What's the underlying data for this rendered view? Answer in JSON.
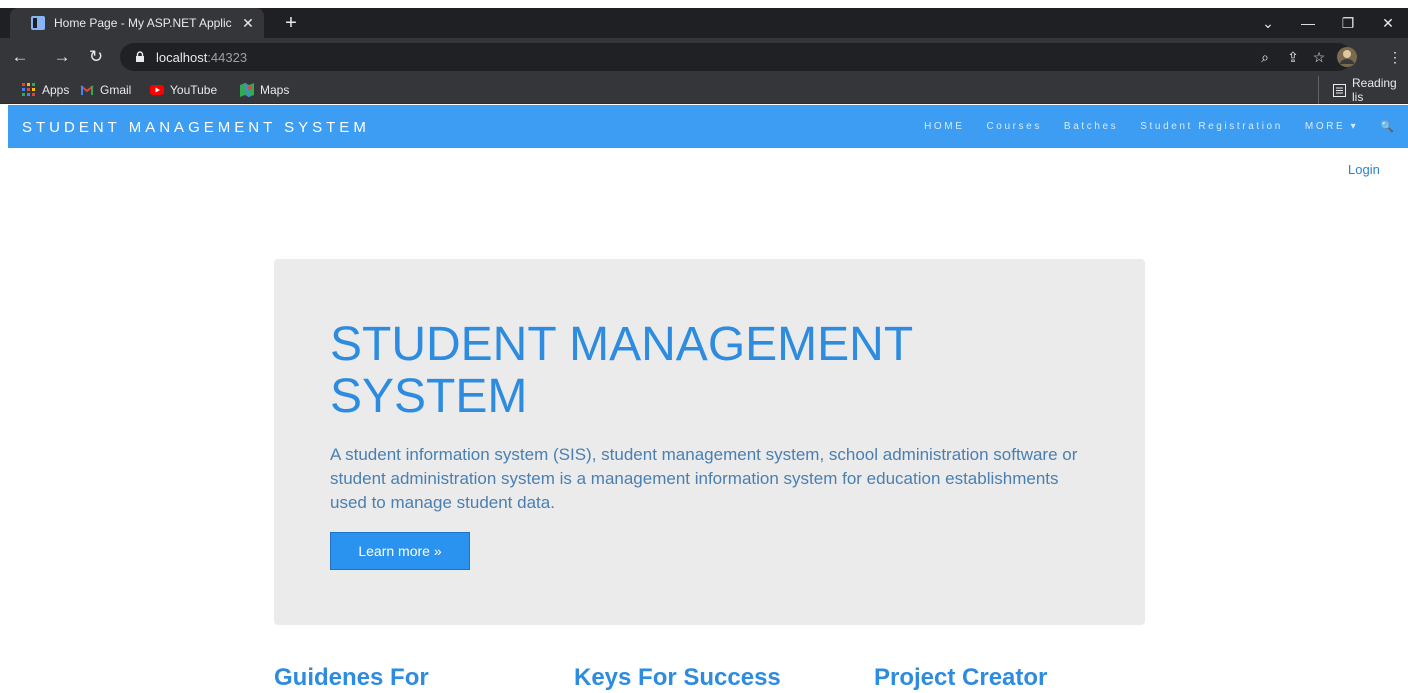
{
  "browser": {
    "tab_title": "Home Page - My ASP.NET Applic",
    "tab_close": "✕",
    "new_tab": "+",
    "address_host": "localhost",
    "address_port": ":44323",
    "bookmarks": [
      {
        "label": "Apps",
        "icon": "apps-grid-icon"
      },
      {
        "label": "Gmail",
        "icon": "gmail-icon"
      },
      {
        "label": "YouTube",
        "icon": "youtube-icon"
      },
      {
        "label": "Maps",
        "icon": "maps-icon"
      }
    ],
    "reading_list": "Reading lis"
  },
  "site": {
    "brand": "STUDENT MANAGEMENT SYSTEM",
    "nav": {
      "home": "HOME",
      "courses": "Courses",
      "batches": "Batches",
      "student_registration": "Student Registration",
      "more": "MORE ▾",
      "search": "🔍"
    },
    "login": "Login",
    "jumbotron": {
      "title": "STUDENT MANAGEMENT SYSTEM",
      "text": "A student information system (SIS), student management system, school administration software or student administration system is a management information system for education establishments used to manage student data.",
      "button": "Learn more »"
    },
    "columns": [
      {
        "heading": "Guidenes For"
      },
      {
        "heading": "Keys For Success"
      },
      {
        "heading": "Project Creator"
      }
    ]
  },
  "colors": {
    "navbar": "#3d9df2",
    "accent": "#2e8ce0",
    "jumbotron_bg": "#ebebeb",
    "button": "#2a93f0"
  }
}
